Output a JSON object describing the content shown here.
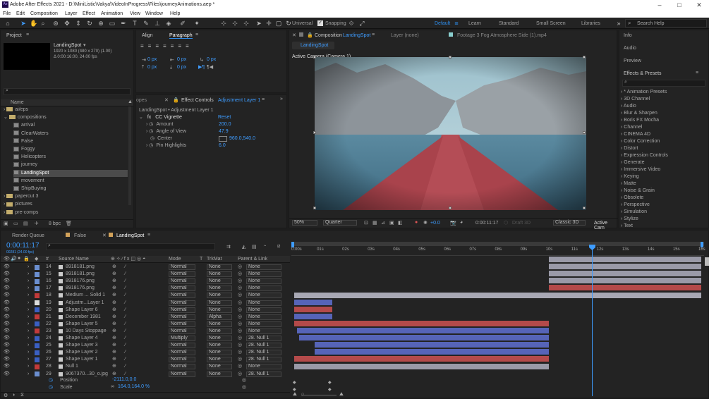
{
  "title": "Adobe After Effects 2021 - D:\\MiniListic\\Vakya\\VideoInProgress\\Files\\journeyAnimations.aep *",
  "app_icon": "Ae",
  "menu": [
    "File",
    "Edit",
    "Composition",
    "Layer",
    "Effect",
    "Animation",
    "View",
    "Window",
    "Help"
  ],
  "toolbar": {
    "universal": "Universal",
    "snapping": "Snapping",
    "workspaces": [
      "Default",
      "Learn",
      "Standard",
      "Small Screen",
      "Libraries"
    ],
    "search_placeholder": "Search Help"
  },
  "project": {
    "tab": "Project",
    "comp_name": "LandingSpot",
    "comp_info1": "1920 x 1080 (480 x 270) (1.00)",
    "comp_info2": "Δ 0:00:16:00, 24.00 fps",
    "col_name": "Name",
    "bpc": "8 bpc",
    "items": [
      {
        "name": "ai/eps",
        "type": "folder",
        "indent": 0
      },
      {
        "name": "compositions",
        "type": "folder",
        "indent": 0
      },
      {
        "name": "arrival",
        "type": "comp",
        "indent": 1
      },
      {
        "name": "ClearWaters",
        "type": "comp",
        "indent": 1
      },
      {
        "name": "False",
        "type": "comp",
        "indent": 1
      },
      {
        "name": "Foggy",
        "type": "comp",
        "indent": 1
      },
      {
        "name": "Helicopters",
        "type": "comp",
        "indent": 1
      },
      {
        "name": "journey",
        "type": "comp",
        "indent": 1
      },
      {
        "name": "LandingSpot",
        "type": "comp",
        "indent": 1,
        "selected": true
      },
      {
        "name": "movement",
        "type": "comp",
        "indent": 1
      },
      {
        "name": "ShipBuying",
        "type": "comp",
        "indent": 1
      },
      {
        "name": "papercut 3",
        "type": "folder",
        "indent": 0
      },
      {
        "name": "pictures",
        "type": "folder",
        "indent": 0
      },
      {
        "name": "pre-comps",
        "type": "folder",
        "indent": 0
      }
    ]
  },
  "align": {
    "tab1": "Align",
    "tab2": "Paragraph",
    "v1": "0 px",
    "v2": "0 px",
    "v3": "0 px",
    "v4": "0 px",
    "v5": "0 px"
  },
  "effects": {
    "tab": "Effect Controls",
    "layer": "Adjustment Layer 1",
    "header": "LandingSpot • Adjustment Layer 1",
    "fx": "CC Vignette",
    "reset": "Reset",
    "props": [
      {
        "name": "Amount",
        "value": "200.0"
      },
      {
        "name": "Angle of View",
        "value": "47.9"
      },
      {
        "name": "Center",
        "value": "960.0,540.0"
      },
      {
        "name": "Pin Highlights",
        "value": "6.0"
      }
    ]
  },
  "composition": {
    "tab": "Composition",
    "name": "LandingSpot",
    "layer_tab": "Layer (none)",
    "footage_tab": "Footage 3 Fog Atmosphere Side (1).mp4",
    "sub_tab": "LandingSpot",
    "camera": "Active Camera (Camera 1)",
    "zoom": "50%",
    "res": "Quarter",
    "exposure": "+0.0",
    "time": "0:00:11:17",
    "draft": "Draft 3D",
    "renderer": "Classic 3D",
    "view": "Active Cam"
  },
  "right": {
    "items": [
      "Info",
      "Audio",
      "Preview"
    ],
    "ep_title": "Effects & Presets",
    "categories": [
      "* Animation Presets",
      "3D Channel",
      "Audio",
      "Blur & Sharpen",
      "Boris FX Mocha",
      "Channel",
      "CINEMA 4D",
      "Color Correction",
      "Distort",
      "Expression Controls",
      "Generate",
      "Immersive Video",
      "Keying",
      "Matte",
      "Noise & Grain",
      "Obsolete",
      "Perspective",
      "Simulation",
      "Stylize",
      "Text"
    ]
  },
  "timeline": {
    "tabs": [
      "Render Queue",
      "False",
      "LandingSpot"
    ],
    "time": "0:00:11:17",
    "frames": "00281 (24.00 fps)",
    "cols": {
      "num": "#",
      "src": "Source Name",
      "mode": "Mode",
      "t": "T",
      "trk": "TrkMat",
      "parent": "Parent & Link"
    },
    "ticks": [
      "0:00s",
      "01s",
      "02s",
      "03s",
      "04s",
      "05s",
      "06s",
      "07s",
      "08s",
      "09s",
      "10s",
      "11s",
      "12s",
      "13s",
      "14s",
      "15s",
      "16s"
    ],
    "playhead_sec": 11.7,
    "duration_sec": 16,
    "layers": [
      {
        "n": "14",
        "name": "8918181.png",
        "color": "#6b8fd0",
        "mode": "Normal",
        "trk": "None",
        "parent": "None",
        "start": 10,
        "end": 16,
        "bar": "#9a9aa8"
      },
      {
        "n": "15",
        "name": "8918181.png",
        "color": "#6b8fd0",
        "mode": "Normal",
        "trk": "None",
        "parent": "None",
        "start": 10,
        "end": 16,
        "bar": "#9a9aa8"
      },
      {
        "n": "16",
        "name": "8918176.png",
        "color": "#6b8fd0",
        "mode": "Normal",
        "trk": "None",
        "parent": "None",
        "start": 10,
        "end": 16,
        "bar": "#9a9aa8"
      },
      {
        "n": "17",
        "name": "8918176.png",
        "color": "#6b8fd0",
        "mode": "Normal",
        "trk": "None",
        "parent": "None",
        "start": 10,
        "end": 16,
        "bar": "#9a9aa8"
      },
      {
        "n": "18",
        "name": "Medium ... Solid 1",
        "color": "#c23a3a",
        "mode": "Normal",
        "trk": "None",
        "parent": "None",
        "start": 10,
        "end": 16,
        "bar": "#b44a4a"
      },
      {
        "n": "19",
        "name": "Adjustm...Layer 1",
        "color": "#dcdcdc",
        "mode": "Normal",
        "trk": "None",
        "parent": "None",
        "start": 0,
        "end": 16,
        "bar": "#a8a8b4"
      },
      {
        "n": "20",
        "name": "Shape Layer 6",
        "color": "#3a5fc2",
        "mode": "Normal",
        "trk": "None",
        "parent": "None",
        "start": 0,
        "end": 1.5,
        "bar": "#5664b8"
      },
      {
        "n": "21",
        "name": "December 1981",
        "color": "#c23a3a",
        "mode": "Normal",
        "trk": "Alpha",
        "parent": "None",
        "start": 0,
        "end": 1.5,
        "bar": "#b44a4a"
      },
      {
        "n": "22",
        "name": "Shape Layer 5",
        "color": "#3a5fc2",
        "mode": "Normal",
        "trk": "None",
        "parent": "None",
        "start": 0,
        "end": 1.5,
        "bar": "#5664b8"
      },
      {
        "n": "23",
        "name": "10 Days Stoppage",
        "color": "#c23a3a",
        "mode": "Normal",
        "trk": "None",
        "parent": "None",
        "start": 0,
        "end": 10,
        "bar": "#b44a4a"
      },
      {
        "n": "24",
        "name": "Shape Layer 4",
        "color": "#3a5fc2",
        "mode": "Multiply",
        "trk": "None",
        "parent": "28. Null 1",
        "start": 0.1,
        "end": 10,
        "bar": "#5664b8"
      },
      {
        "n": "25",
        "name": "Shape Layer 3",
        "color": "#3a5fc2",
        "mode": "Normal",
        "trk": "None",
        "parent": "28. Null 1",
        "start": 0.2,
        "end": 10,
        "bar": "#5664b8"
      },
      {
        "n": "26",
        "name": "Shape Layer 2",
        "color": "#3a5fc2",
        "mode": "Normal",
        "trk": "None",
        "parent": "28. Null 1",
        "start": 0.8,
        "end": 10,
        "bar": "#5664b8"
      },
      {
        "n": "27",
        "name": "Shape Layer 1",
        "color": "#3a5fc2",
        "mode": "Normal",
        "trk": "None",
        "parent": "28. Null 1",
        "start": 0.8,
        "end": 10,
        "bar": "#5664b8"
      },
      {
        "n": "28",
        "name": "Null 1",
        "color": "#c23a3a",
        "mode": "Normal",
        "trk": "None",
        "parent": "None",
        "start": 0,
        "end": 10,
        "bar": "#b44a4a"
      },
      {
        "n": "29",
        "name": "9067370...30_o.jpg",
        "color": "#6b8fd0",
        "mode": "Normal",
        "trk": "None",
        "parent": "28. Null 1",
        "start": 0,
        "end": 10,
        "bar": "#9a9aa8"
      }
    ],
    "props": [
      {
        "name": "Position",
        "value": "-2111.0,0.0"
      },
      {
        "name": "Scale",
        "value": "164.0,164.0 %"
      }
    ]
  },
  "colors": {
    "accent": "#2d8ceb",
    "panel": "#232323",
    "bg": "#1d1d1d"
  }
}
